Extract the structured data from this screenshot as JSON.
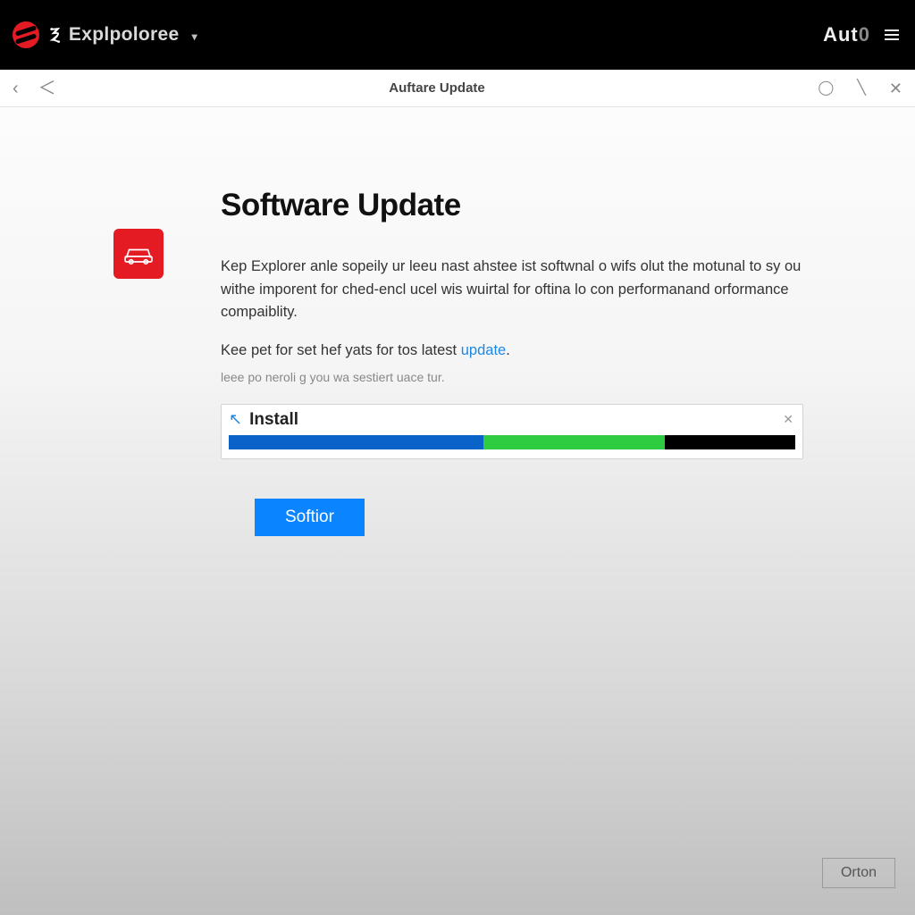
{
  "topbar": {
    "brand_name": "Explpoloree",
    "brand_mark2": "Ⲝ",
    "right_label": "Aut",
    "right_label_zero": "0"
  },
  "navbar": {
    "title": "Auftare Update"
  },
  "page": {
    "title": "Software Update",
    "desc1": "Kep Explorer anle sopeily ur leeu nast ahstee ist softwnal o wifs olut the motunal to sy ou withe imporent for ched-encl ucel wis wuirtal for oftina lo con performanand orformance compaiblity.",
    "desc2_prefix": "Kee pet for set hef yats for tos latest ",
    "desc2_link": "update",
    "desc2_suffix": ".",
    "desc3": "leee po neroli g you wa sestiert uace tur."
  },
  "install": {
    "label": "Install",
    "progress_blue_pct": 45,
    "progress_green_pct": 32
  },
  "actions": {
    "primary": "Softior",
    "footer": "Orton"
  }
}
